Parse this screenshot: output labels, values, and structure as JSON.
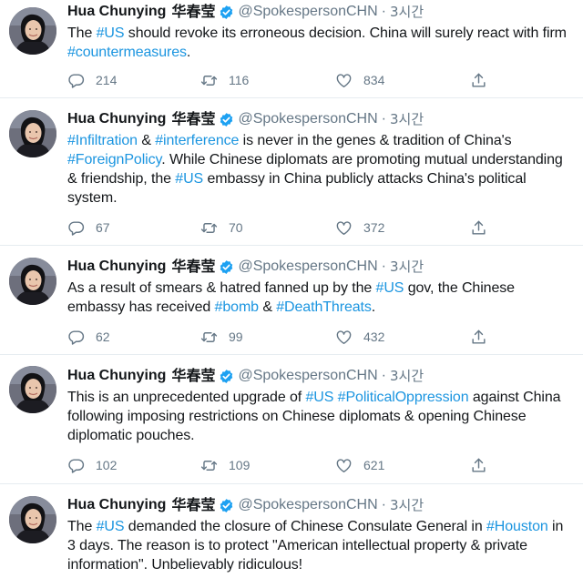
{
  "colors": {
    "link": "#1b95e0",
    "text": "#14171a",
    "secondary": "#657786",
    "divider": "#e6ecf0",
    "verified": "#1da1f2"
  },
  "tweets": [
    {
      "name": "Hua Chunying",
      "name_cn": "华春莹",
      "handle": "@SpokespersonCHN",
      "separator": "·",
      "time": "3시간",
      "body": [
        {
          "t": "The "
        },
        {
          "t": "#US",
          "tag": true
        },
        {
          "t": " should revoke its erroneous decision. China will surely react with firm "
        },
        {
          "t": "#countermeasures",
          "tag": true
        },
        {
          "t": "."
        }
      ],
      "replies": "214",
      "retweets": "116",
      "likes": "834"
    },
    {
      "name": "Hua Chunying",
      "name_cn": "华春莹",
      "handle": "@SpokespersonCHN",
      "separator": "·",
      "time": "3시간",
      "body": [
        {
          "t": "#Infiltration",
          "tag": true
        },
        {
          "t": " & "
        },
        {
          "t": "#interference",
          "tag": true
        },
        {
          "t": " is never in the genes & tradition of China's "
        },
        {
          "t": "#ForeignPolicy",
          "tag": true
        },
        {
          "t": ". While Chinese diplomats are promoting mutual understanding & friendship, the "
        },
        {
          "t": "#US",
          "tag": true
        },
        {
          "t": " embassy in China publicly attacks China's political system."
        }
      ],
      "replies": "67",
      "retweets": "70",
      "likes": "372"
    },
    {
      "name": "Hua Chunying",
      "name_cn": "华春莹",
      "handle": "@SpokespersonCHN",
      "separator": "·",
      "time": "3시간",
      "body": [
        {
          "t": "As a result of smears & hatred fanned up by the "
        },
        {
          "t": "#US",
          "tag": true
        },
        {
          "t": " gov, the Chinese embassy has received "
        },
        {
          "t": "#bomb",
          "tag": true
        },
        {
          "t": " & "
        },
        {
          "t": "#DeathThreats",
          "tag": true
        },
        {
          "t": "."
        }
      ],
      "replies": "62",
      "retweets": "99",
      "likes": "432"
    },
    {
      "name": "Hua Chunying",
      "name_cn": "华春莹",
      "handle": "@SpokespersonCHN",
      "separator": "·",
      "time": "3시간",
      "body": [
        {
          "t": "This is an unprecedented upgrade of "
        },
        {
          "t": "#US",
          "tag": true
        },
        {
          "t": " "
        },
        {
          "t": "#PoliticalOppression",
          "tag": true
        },
        {
          "t": " against China following imposing restrictions on Chinese diplomats & opening Chinese diplomatic pouches."
        }
      ],
      "replies": "102",
      "retweets": "109",
      "likes": "621"
    },
    {
      "name": "Hua Chunying",
      "name_cn": "华春莹",
      "handle": "@SpokespersonCHN",
      "separator": "·",
      "time": "3시간",
      "body": [
        {
          "t": "The "
        },
        {
          "t": "#US",
          "tag": true
        },
        {
          "t": " demanded the closure of Chinese Consulate General in "
        },
        {
          "t": "#Houston",
          "tag": true
        },
        {
          "t": " in 3 days. The reason is to protect \"American intellectual property & private information\". Unbelievably ridiculous!"
        }
      ],
      "replies": "",
      "retweets": "",
      "likes": ""
    }
  ]
}
